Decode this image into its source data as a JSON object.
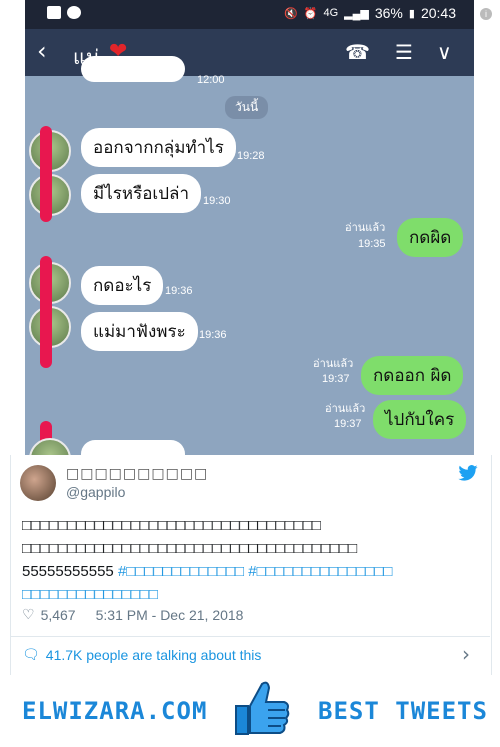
{
  "status_bar": {
    "battery": "36%",
    "time": "20:43",
    "network": "4G"
  },
  "app_bar": {
    "title": "แม่",
    "heart": "❤"
  },
  "chat": {
    "top_time": "12:00",
    "date_label": "วันนี้",
    "messages": [
      {
        "side": "left",
        "text": "ออกจากกลุ่มทำไร",
        "time": "19:28"
      },
      {
        "side": "left",
        "text": "มีไรหรือเปล่า",
        "time": "19:30"
      },
      {
        "side": "right",
        "text": "กดผิด",
        "read": "อ่านแล้ว",
        "time": "19:35"
      },
      {
        "side": "left",
        "text": "กดอะไร",
        "time": "19:36"
      },
      {
        "side": "left",
        "text": "แม่มาฟังพระ",
        "time": "19:36"
      },
      {
        "side": "right",
        "text": "กดออก ผิด",
        "read": "อ่านแล้ว",
        "time": "19:37"
      },
      {
        "side": "right",
        "text": "ไปกับใคร",
        "read": "อ่านแล้ว",
        "time": "19:37"
      }
    ]
  },
  "tweet": {
    "name": "□□□□□□□□□□",
    "handle": "@gappilo",
    "text_line1": "□□□□□□□□□□□□□□□□□□□□□□□□□□□□□□□□□",
    "text_line2": "□□□□□□□□□□□□□□□□□□□□□□□□□□□□□□□□□□□□□",
    "text_number": "55555555555",
    "hashtag1": "#□□□□□□□□□□□□□",
    "hashtag2": "#□□□□□□□□□□□□□□□",
    "text_line4": "□□□□□□□□□□□□□□□",
    "likes": "5,467",
    "timestamp": "5:31 PM - Dec 21, 2018",
    "talking": "41.7K people are talking about this"
  },
  "banner": {
    "brand": "ELWIZARA.COM",
    "tagline": "BEST TWEETS"
  },
  "colors": {
    "accent": "#1b87d8",
    "chat_bg": "#8ea5bf",
    "my_bubble": "#7fdd6b",
    "appbar": "#2d3b55"
  }
}
